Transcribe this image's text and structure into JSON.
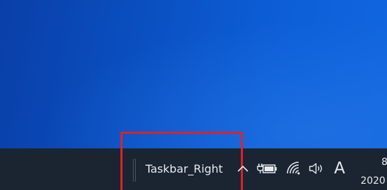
{
  "taskbar": {
    "toolbar_label": "Taskbar_Right",
    "highlight_color": "#e0202c",
    "background_color": "#1b2431"
  },
  "tray": {
    "icons": [
      "chevron-up-icon",
      "battery-charging-icon",
      "wifi-icon",
      "volume-icon"
    ],
    "ime_indicator": "A"
  },
  "clock": {
    "time": "8",
    "date": "2020"
  }
}
